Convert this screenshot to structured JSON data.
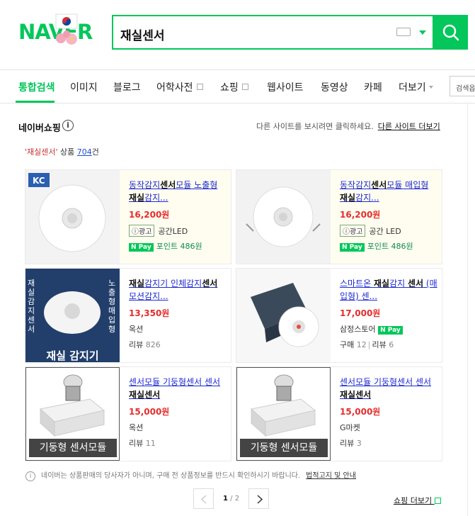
{
  "header": {
    "logo_text": "NAVER",
    "search_query": "재실센서",
    "search_button": "search"
  },
  "tabs": [
    {
      "label": "통합검색",
      "active": true
    },
    {
      "label": "이미지"
    },
    {
      "label": "블로그"
    },
    {
      "label": "어학사전",
      "external": true
    },
    {
      "label": "쇼핑",
      "external": true
    },
    {
      "label": "웹사이트"
    },
    {
      "label": "동영상"
    },
    {
      "label": "카페"
    },
    {
      "label": "더보기"
    }
  ],
  "tab_search_option": "검색옵",
  "section": {
    "title": "네이버쇼핑",
    "other_sites_text": "다른 사이트를 보시려면 클릭하세요.",
    "other_sites_link": "다른 사이트 더보기",
    "count_keyword": "'재실센서'",
    "count_label": "상품",
    "count_number": "704",
    "count_suffix": "건"
  },
  "products": [
    {
      "title_pre": "동작감지",
      "title_b1": "센서",
      "title_mid": "모듈 노출형 ",
      "title_b2": "재실",
      "title_post": "감지...",
      "price": "16,200원",
      "ad_label": "광고",
      "seller": "공간LED",
      "npay": "Pay",
      "point": "포인트 486원"
    },
    {
      "title_pre": "동작감지",
      "title_b1": "센서",
      "title_mid": "모듈 매입형 ",
      "title_b2": "재실",
      "title_post": "감지...",
      "price": "16,200원",
      "ad_label": "광고",
      "seller": "공간 LED",
      "npay": "Pay",
      "point": "포인트 486원"
    },
    {
      "title_pre": "",
      "title_b1": "재실",
      "title_mid": "감지기 인체감지",
      "title_b2": "센서",
      "title_post": " 모션감지...",
      "price": "13,350원",
      "seller": "옥션",
      "review_label": "리뷰",
      "review_count": "826",
      "image_caption": "재실 감지기",
      "image_side_left": "재실감지센서",
      "image_side_right": "노출형 매입형"
    },
    {
      "title_pre": "스마트온 ",
      "title_b1": "재실",
      "title_mid": "감지 ",
      "title_b2": "센서",
      "title_post": " (매입형) 센...",
      "price": "17,000원",
      "seller": "삼정스토어",
      "npay": "Pay",
      "buy_label": "구매",
      "buy_count": "12",
      "review_label": "리뷰",
      "review_count": "6"
    },
    {
      "title_pre": "센서모듈 기둥형센서 센서 ",
      "title_b1": "재실센서",
      "title_mid": "",
      "title_b2": "",
      "title_post": "",
      "price": "15,000원",
      "seller": "옥션",
      "review_label": "리뷰",
      "review_count": "11",
      "image_caption": "기둥형 센서모듈"
    },
    {
      "title_pre": "센서모듈 기둥형센서 센서 ",
      "title_b1": "재실센서",
      "title_mid": "",
      "title_b2": "",
      "title_post": "",
      "price": "15,000원",
      "seller": "G마켓",
      "review_label": "리뷰",
      "review_count": "3",
      "image_caption": "기둥형 센서모듈"
    }
  ],
  "notice": {
    "text": "네이버는 상품판매의 당사자가 아니며, 구매 전 상품정보를 반드시 확인하시기 바랍니다.",
    "legal_link": "법적고지 및 안내"
  },
  "pager": {
    "current": "1",
    "separator": "/",
    "total": "2"
  },
  "shop_more": "쇼핑 더보기",
  "colors": {
    "brand_green": "#03c75a",
    "price_red": "#e62d2d",
    "link_blue": "#1e2bd2"
  }
}
